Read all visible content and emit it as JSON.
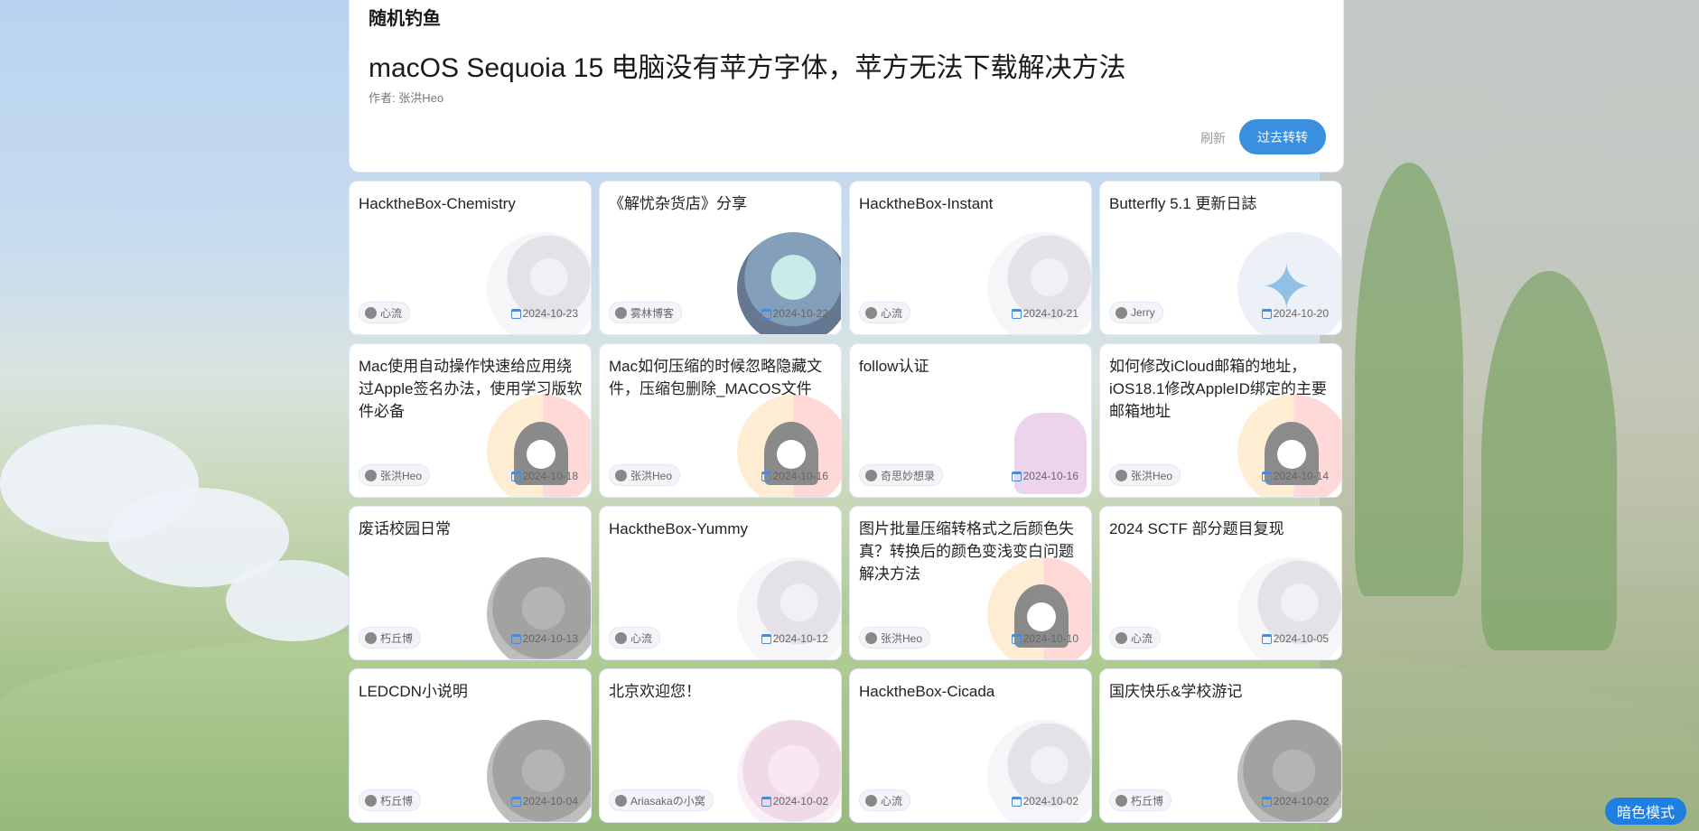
{
  "hero": {
    "section_title": "随机钓鱼",
    "post_title": "macOS Sequoia 15 电脑没有苹方字体，苹方无法下载解决方法",
    "author": "作者: 张洪Heo",
    "refresh_label": "刷新",
    "go_label": "过去转转"
  },
  "cards": [
    {
      "title": "HacktheBox-Chemistry",
      "author": "心流",
      "date": "2024-10-23",
      "art": "girl-avatar"
    },
    {
      "title": "《解忧杂货店》分享",
      "author": "雾林博客",
      "date": "2024-10-22",
      "art": "teal-character"
    },
    {
      "title": "HacktheBox-Instant",
      "author": "心流",
      "date": "2024-10-21",
      "art": "girl-avatar"
    },
    {
      "title": "Butterfly 5.1 更新日誌",
      "author": "Jerry",
      "date": "2024-10-20",
      "art": "butterfly-logo"
    },
    {
      "title": "Mac使用自动操作快速给应用绕过Apple签名办法，使用学习版软件必备",
      "author": "张洪Heo",
      "date": "2024-10-18",
      "art": "sheep-avatar"
    },
    {
      "title": "Mac如何压缩的时候忽略隐藏文件，压缩包删除_MACOS文件",
      "author": "张洪Heo",
      "date": "2024-10-16",
      "art": "sheep-avatar"
    },
    {
      "title": "follow认证",
      "author": "奇思妙想录",
      "date": "2024-10-16",
      "art": "unicorn-cat"
    },
    {
      "title": "如何修改iCloud邮箱的地址，iOS18.1修改AppleID绑定的主要邮箱地址",
      "author": "张洪Heo",
      "date": "2024-10-14",
      "art": "sheep-avatar"
    },
    {
      "title": "废话校园日常",
      "author": "朽丘博",
      "date": "2024-10-13",
      "art": "dark-girl"
    },
    {
      "title": "HacktheBox-Yummy",
      "author": "心流",
      "date": "2024-10-12",
      "art": "girl-avatar"
    },
    {
      "title": "图片批量压缩转格式之后颜色失真？转换后的颜色变浅变白问题解决方法",
      "author": "张洪Heo",
      "date": "2024-10-10",
      "art": "sheep-avatar"
    },
    {
      "title": "2024 SCTF 部分题目复现",
      "author": "心流",
      "date": "2024-10-05",
      "art": "girl-avatar"
    },
    {
      "title": "LEDCDN小说明",
      "author": "朽丘博",
      "date": "2024-10-04",
      "art": "dark-girl"
    },
    {
      "title": "北京欢迎您！",
      "author": "Ariasakaの小窝",
      "date": "2024-10-02",
      "art": "pink-girl"
    },
    {
      "title": "HacktheBox-Cicada",
      "author": "心流",
      "date": "2024-10-02",
      "art": "girl-avatar"
    },
    {
      "title": "国庆快乐&学校游记",
      "author": "朽丘博",
      "date": "2024-10-02",
      "art": "dark-girl"
    }
  ],
  "dark_mode_label": "暗色模式",
  "colors": {
    "accent": "#3b8fdf",
    "dark_button": "#1e7fe0"
  }
}
